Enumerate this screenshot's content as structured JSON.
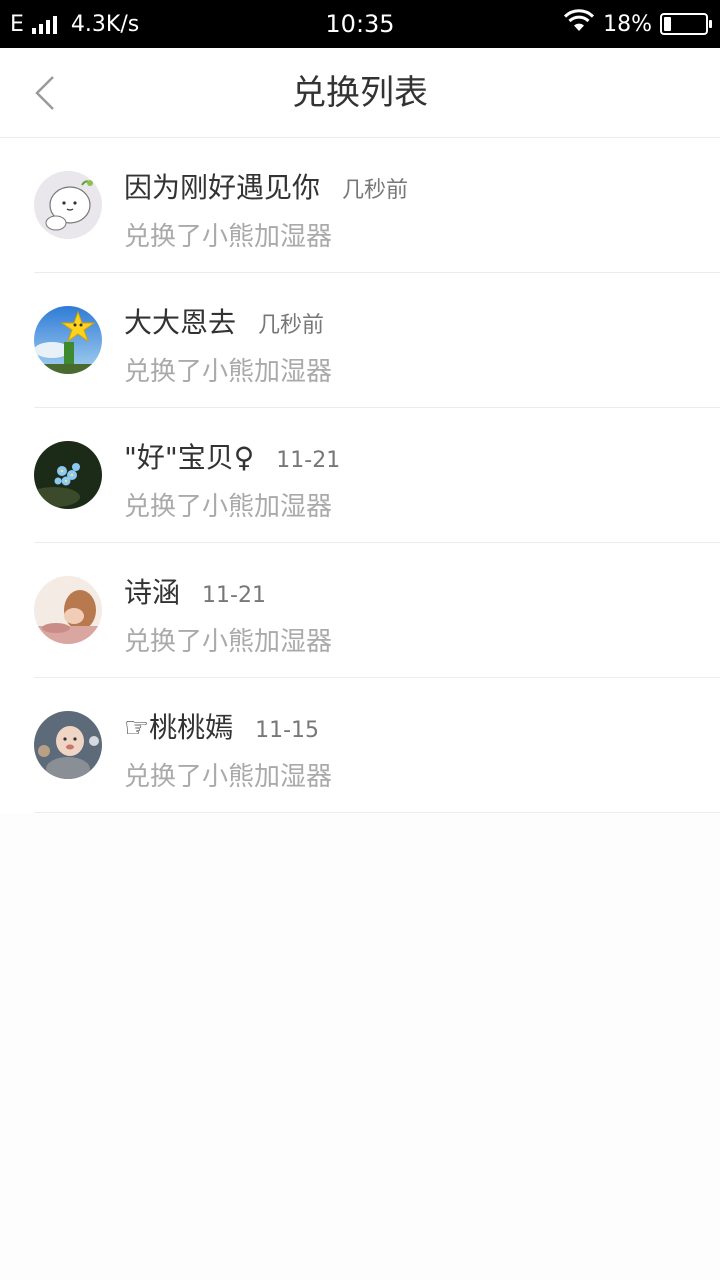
{
  "status_bar": {
    "network_type": "E",
    "speed": "4.3K/s",
    "time": "10:35",
    "battery_percent_text": "18%",
    "battery_level": 0.18,
    "icons": [
      "signal-icon",
      "wifi-icon",
      "battery-icon"
    ]
  },
  "header": {
    "title": "兑换列表",
    "back_icon": "chevron-left-icon"
  },
  "items": [
    {
      "name": "因为刚好遇见你",
      "time": "几秒前",
      "desc": "兑换了小熊加湿器"
    },
    {
      "name": "大大恩去",
      "time": "几秒前",
      "desc": "兑换了小熊加湿器"
    },
    {
      "name": "\"好\"宝贝♀",
      "time": "11-21",
      "desc": "兑换了小熊加湿器"
    },
    {
      "name": "诗涵",
      "time": "11-21",
      "desc": "兑换了小熊加湿器"
    },
    {
      "name": "☞桃桃嫣",
      "time": "11-15",
      "desc": "兑换了小熊加湿器"
    }
  ],
  "colors": {
    "status_bar_bg": "#000000",
    "title_text": "#333333",
    "desc_text": "#aaaaaa",
    "divider": "#ececec"
  }
}
